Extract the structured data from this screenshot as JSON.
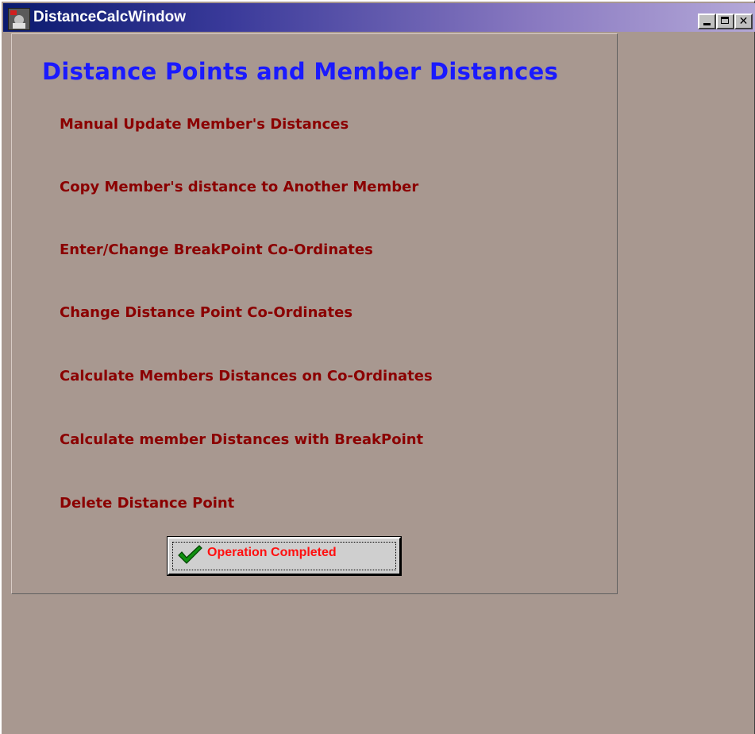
{
  "window": {
    "title": "DistanceCalcWindow",
    "controls": {
      "minimize": "minimize-icon",
      "maximize": "maximize-icon",
      "close": "close-icon"
    },
    "background_color": "#a89890"
  },
  "panel": {
    "heading": "Distance Points and Member Distances",
    "menu_items": [
      {
        "label": "Manual Update Member's Distances"
      },
      {
        "label": "Copy Member's distance to Another Member"
      },
      {
        "label": "Enter/Change BreakPoint Co-Ordinates"
      },
      {
        "label": "Change Distance Point Co-Ordinates"
      },
      {
        "label": "Calculate Members Distances on Co-Ordinates"
      },
      {
        "label": "Calculate member Distances with  BreakPoint"
      },
      {
        "label": "Delete Distance Point"
      }
    ],
    "status_button": {
      "label": "Operation Completed",
      "icon": "checkmark-icon"
    }
  },
  "colors": {
    "heading": "#1a1aff",
    "menu_text": "#8b0000",
    "status_text": "#ff1010",
    "check": "#109010"
  }
}
